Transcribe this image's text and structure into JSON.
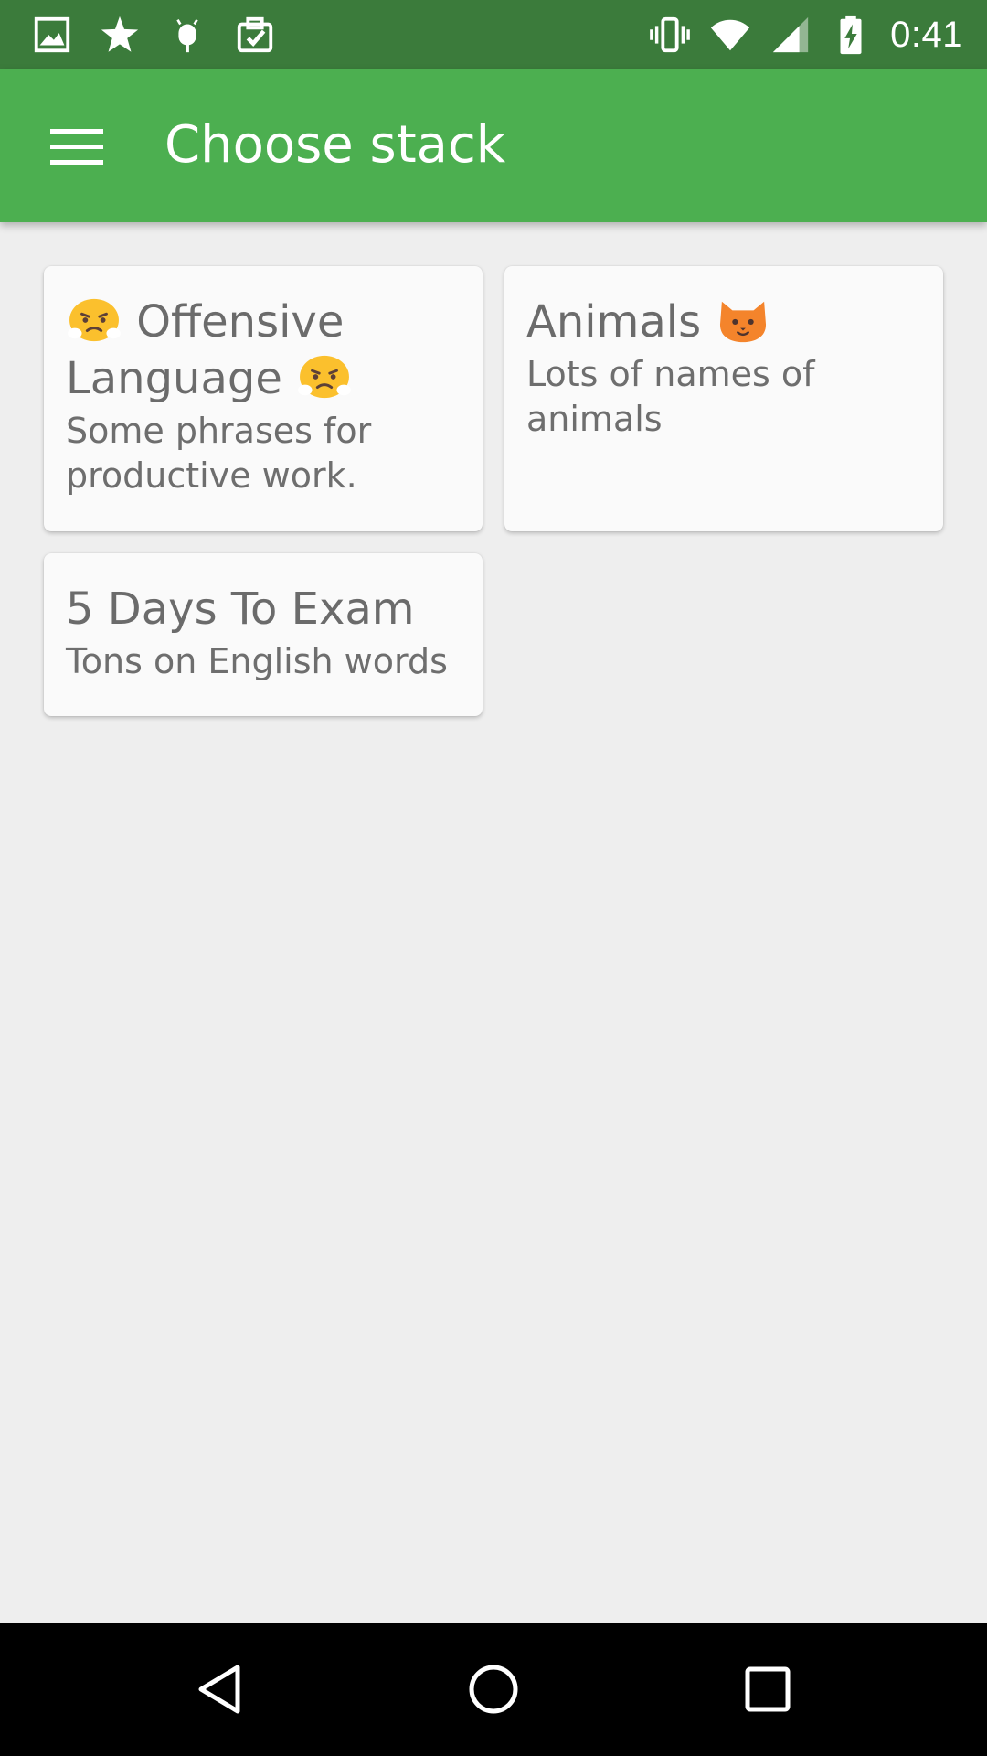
{
  "status_bar": {
    "time": "0:41",
    "left_icons": [
      "image-icon",
      "star-icon",
      "android-icon",
      "clipboard-check-icon"
    ],
    "right_icons": [
      "vibrate-icon",
      "wifi-icon",
      "cell-signal-icon",
      "battery-charging-icon"
    ],
    "background": "#3b7b3b"
  },
  "app_bar": {
    "title": "Choose stack",
    "menu_icon": "hamburger-menu-icon",
    "background": "#4caf50"
  },
  "stacks": [
    {
      "title_pre_emoji": "angry-face-emoji",
      "title": "Offensive Language",
      "title_post_emoji": "angry-face-emoji",
      "description": "Some phrases for productive work."
    },
    {
      "title": "Animals",
      "title_post_emoji": "cat-face-emoji",
      "description": "Lots of names of animals"
    },
    {
      "title": "5 Days To Exam",
      "description": "Tons on English words"
    }
  ],
  "nav_bar": {
    "buttons": [
      "back-icon",
      "home-icon",
      "recents-icon"
    ]
  }
}
